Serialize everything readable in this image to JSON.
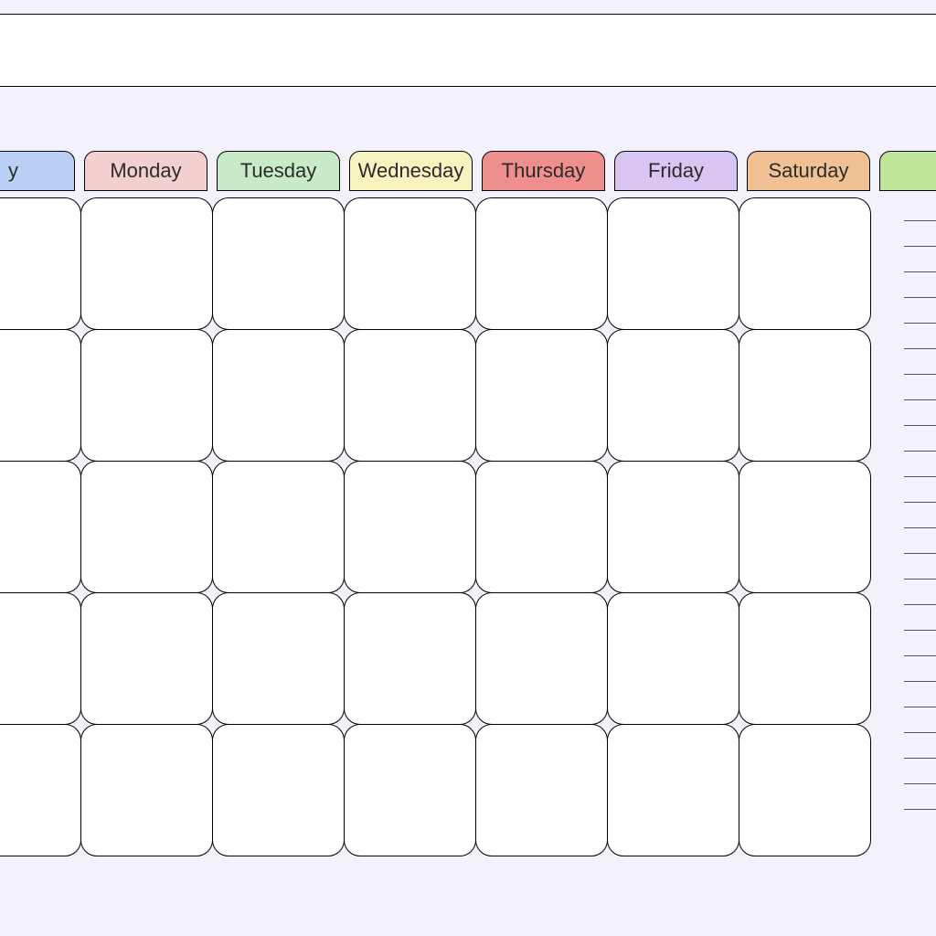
{
  "title": "",
  "days": [
    {
      "label": "y",
      "color": "#b9cff3"
    },
    {
      "label": "Monday",
      "color": "#f3cfcf"
    },
    {
      "label": "Tuesday",
      "color": "#c9eac9"
    },
    {
      "label": "Wednesday",
      "color": "#f7f3bf"
    },
    {
      "label": "Thursday",
      "color": "#ef8f8d"
    },
    {
      "label": "Friday",
      "color": "#d9c5f2"
    },
    {
      "label": "Saturday",
      "color": "#f1c093"
    },
    {
      "label": "",
      "color": "#bfe59a"
    }
  ],
  "rows": 5,
  "cols": 7,
  "notes_lines": 24
}
